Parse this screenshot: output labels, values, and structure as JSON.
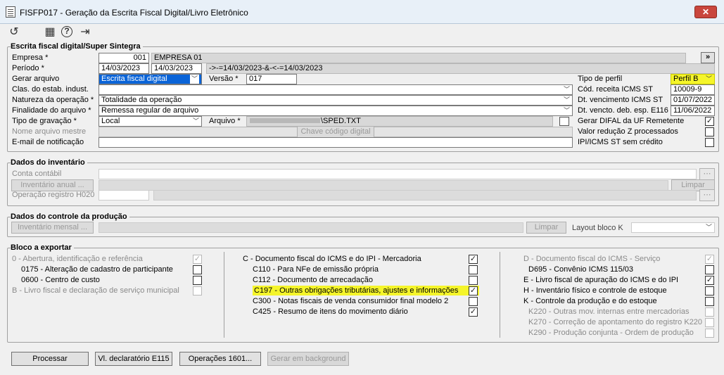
{
  "window": {
    "title": "FISFP017 - Geração da Escrita Fiscal Digital/Livro Eletrônico",
    "close": "✕"
  },
  "toolbar": {
    "undo": "↺",
    "calendar": "▦",
    "help": "?",
    "exit": "⇥"
  },
  "escrita": {
    "title": "Escrita fiscal digital/Super Sintegra",
    "empresa_label": "Empresa *",
    "empresa_code": "001",
    "empresa_name": "EMPRESA 01",
    "expand": "»",
    "periodo_label": "Período *",
    "periodo_ini": "14/03/2023",
    "periodo_fim": "14/03/2023",
    "periodo_expr": "->-=14/03/2023-&-<-=14/03/2023",
    "gerar_label": "Gerar arquivo",
    "gerar_value": "Escrita fiscal digital",
    "versao_label": "Versão *",
    "versao_value": "017",
    "clas_label": "Clas. do estab. indust.",
    "clas_value": "",
    "natureza_label": "Natureza da operação *",
    "natureza_value": "Totalidade da operação",
    "finalidade_label": "Finalidade do arquivo *",
    "finalidade_value": "Remessa regular de arquivo",
    "tipo_grav_label": "Tipo de gravação *",
    "tipo_grav_value": "Local",
    "arquivo_label": "Arquivo *",
    "arquivo_value": "\\SPED.TXT",
    "nome_mestre_label": "Nome arquivo mestre",
    "chave_btn": "Chave código digital",
    "email_label": "E-mail de notificação",
    "email_value": "",
    "tipo_perfil_label": "Tipo de perfil",
    "tipo_perfil_value": "Perfil B",
    "cod_receita_label": "Cód. receita ICMS ST",
    "cod_receita_value": "10009-9",
    "dt_venc_label": "Dt. vencimento ICMS ST",
    "dt_venc_value": "01/07/2022",
    "dt_venc_deb_label": "Dt. vencto. deb. esp. E116",
    "dt_venc_deb_value": "11/06/2022",
    "difal_label": "Gerar DIFAL da UF Remetente",
    "difal_checked": true,
    "reducao_label": "Valor redução Z processados",
    "reducao_checked": false,
    "ipi_label": "IPI/ICMS ST sem crédito",
    "ipi_checked": false
  },
  "inventario": {
    "title": "Dados do inventário",
    "conta_label": "Conta contábil",
    "anual_btn": "Inventário anual ...",
    "limpar_btn": "Limpar",
    "h020_label": "Operação registro H020"
  },
  "producao": {
    "title": "Dados do controle da produção",
    "mensal_btn": "Inventário mensal ...",
    "limpar_btn": "Limpar",
    "layout_label": "Layout bloco K"
  },
  "bloco": {
    "title": "Bloco a exportar",
    "col1": [
      {
        "label": "0 - Abertura, identificação e referência",
        "checked": true,
        "disabled": true,
        "indent": false
      },
      {
        "label": "0175 - Alteração de cadastro de participante",
        "checked": false,
        "disabled": false,
        "indent": true
      },
      {
        "label": "0600 - Centro de custo",
        "checked": false,
        "disabled": false,
        "indent": true
      },
      {
        "label": "B - Livro fiscal e declaração de serviço municipal",
        "checked": false,
        "disabled": true,
        "indent": false
      }
    ],
    "col2": [
      {
        "label": "C - Documento fiscal do ICMS e do IPI - Mercadoria",
        "checked": true,
        "disabled": false,
        "indent": false,
        "hl": false
      },
      {
        "label": "C110 - Para NFe de emissão própria",
        "checked": false,
        "disabled": false,
        "indent": true,
        "hl": false
      },
      {
        "label": "C112 - Documento de arrecadação",
        "checked": false,
        "disabled": false,
        "indent": true,
        "hl": false
      },
      {
        "label": "C197 - Outras obrigações tributárias, ajustes e informações",
        "checked": true,
        "disabled": false,
        "indent": true,
        "hl": true
      },
      {
        "label": "C300 - Notas fiscais de venda consumidor final modelo 2",
        "checked": false,
        "disabled": false,
        "indent": true,
        "hl": false
      },
      {
        "label": "C425 - Resumo de itens do movimento diário",
        "checked": true,
        "disabled": false,
        "indent": true,
        "hl": false
      }
    ],
    "col3": [
      {
        "label": "D - Documento fiscal do ICMS - Serviço",
        "checked": true,
        "disabled": true,
        "indent": false
      },
      {
        "label": "D695 - Convênio ICMS 115/03",
        "checked": false,
        "disabled": false,
        "indent": true
      },
      {
        "label": "E - Livro fiscal de apuração do ICMS e do IPI",
        "checked": true,
        "disabled": false,
        "indent": false
      },
      {
        "label": "H - Inventário físico e controle de estoque",
        "checked": false,
        "disabled": false,
        "indent": false
      },
      {
        "label": "K - Controle da produção e do estoque",
        "checked": false,
        "disabled": false,
        "indent": false
      },
      {
        "label": "K220 - Outras mov. internas entre mercadorias",
        "checked": false,
        "disabled": true,
        "indent": true
      },
      {
        "label": "K270 - Correção de apontamento do registro K220",
        "checked": false,
        "disabled": true,
        "indent": true
      },
      {
        "label": "K290 - Produção conjunta - Ordem de produção",
        "checked": false,
        "disabled": true,
        "indent": true
      }
    ]
  },
  "footer": {
    "processar": "Processar",
    "vl_decl": "Vl. declaratório E115",
    "operacoes": "Operações 1601...",
    "background": "Gerar em background"
  }
}
